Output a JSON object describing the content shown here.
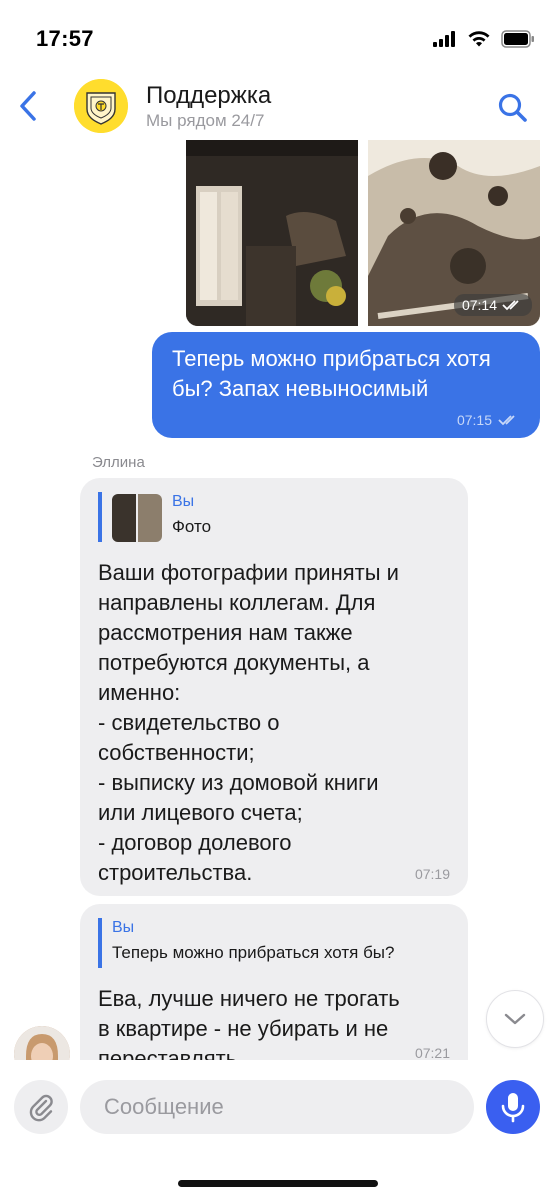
{
  "status_bar": {
    "time": "17:57",
    "icons": [
      "signal-icon",
      "wifi-icon",
      "battery-icon"
    ]
  },
  "header": {
    "title": "Поддержка",
    "subtitle": "Мы рядом 24/7",
    "icons": [
      "back-arrow-icon",
      "bank-logo-icon",
      "search-icon"
    ],
    "accent_color": "#3a73e6"
  },
  "messages": {
    "photo_album": {
      "time": "07:14"
    },
    "outgoing_1": {
      "text": "Теперь можно прибраться хотя бы? Запах невыносимый",
      "time": "07:15"
    },
    "agent_name": "Эллина",
    "incoming_1": {
      "quote_author": "Вы",
      "quote_text": "Фото",
      "text": "Ваши фотографии приняты и\nнаправлены коллегам. Для\nрассмотрения нам также\nпотребуются документы, а\nименно:\n- свидетельство о\nсобственности;\n- выписку из домовой книги\nили лицевого счета;\n- договор долевого\nстроительства.",
      "time": "07:19"
    },
    "incoming_2": {
      "quote_author": "Вы",
      "quote_text": "Теперь можно прибраться хотя бы?",
      "text": "Ева, лучше ничего не трогать\nв квартире - не убирать и не\nпереставлять",
      "time": "07:21"
    }
  },
  "composer": {
    "placeholder": "Сообщение",
    "icons": [
      "paperclip-icon",
      "microphone-icon"
    ],
    "mic_color": "#3a5ff0"
  },
  "colors": {
    "outgoing_bubble": "#3a73e6",
    "incoming_bubble": "#eeeef0"
  }
}
